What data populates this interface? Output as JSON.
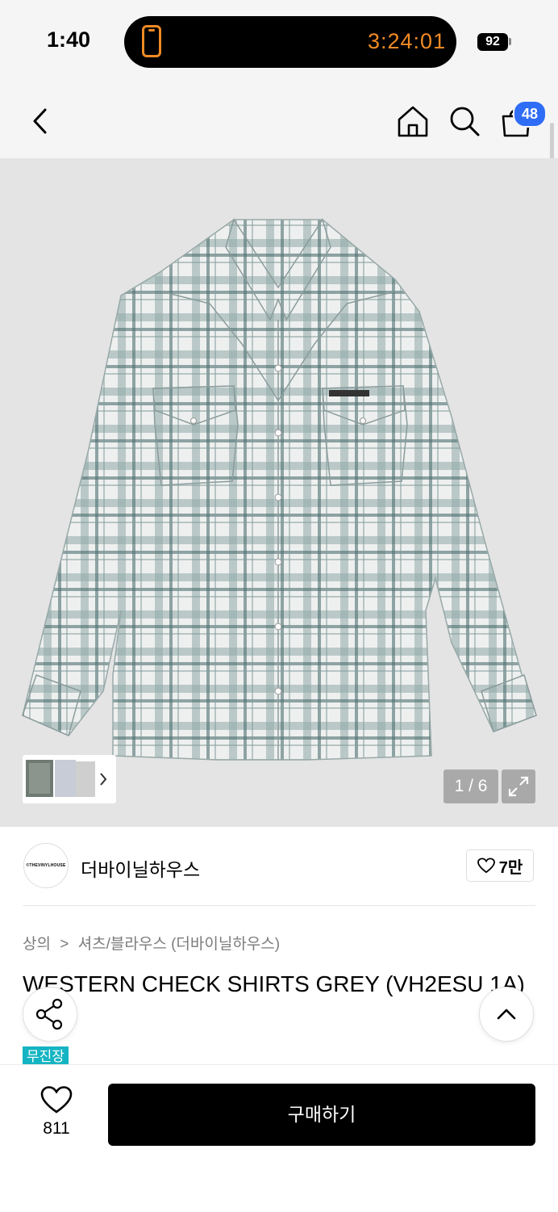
{
  "status_bar": {
    "time": "1:40",
    "timer": "3:24:01",
    "battery": "92"
  },
  "nav": {
    "cart_badge": "48"
  },
  "gallery": {
    "counter": "1 / 6"
  },
  "brand": {
    "logo_text": "©THEVINYLHOUSE",
    "name": "더바이닐하우스",
    "likes": "7만"
  },
  "product": {
    "breadcrumb_category": "상의",
    "breadcrumb_sep": ">",
    "breadcrumb_sub": "셔츠/블라우스 (더바이닐하우스)",
    "title": "WESTERN CHECK SHIRTS GREY (VH2ESU 1A)",
    "tag": "무진장"
  },
  "bottom_bar": {
    "like_count": "811",
    "buy_label": "구매하기"
  },
  "colors": {
    "accent_badge": "#2f6df6",
    "timer": "#f08a24",
    "tag": "#14b4c3"
  }
}
